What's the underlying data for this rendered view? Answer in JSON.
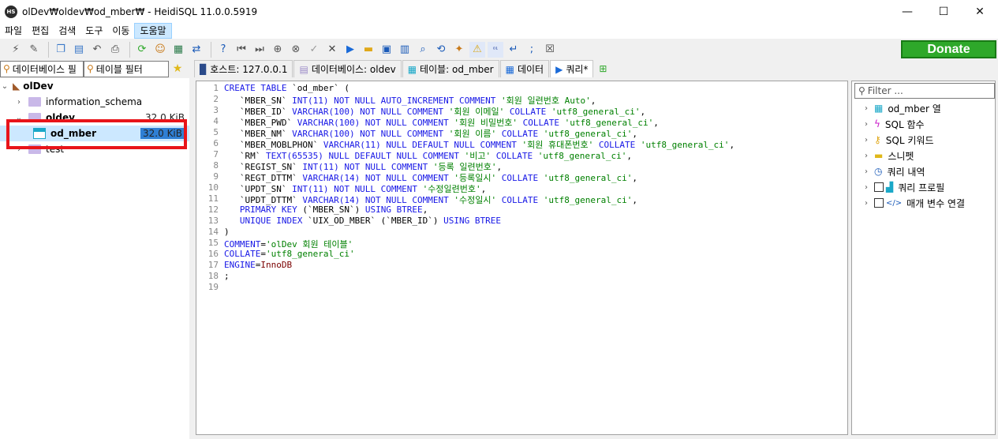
{
  "window": {
    "title": "olDev₩oldev₩od_mber₩ - HeidiSQL 11.0.0.5919",
    "app_icon_text": "HS",
    "minimize": "—",
    "maximize": "☐",
    "close": "✕"
  },
  "menu": [
    "파일",
    "편집",
    "검색",
    "도구",
    "이동",
    "도움말"
  ],
  "donate_label": "Donate",
  "left": {
    "db_filter": "데이터베이스 필",
    "table_filter": "테이블 필터",
    "tree": [
      {
        "label": "olDev",
        "size": ""
      },
      {
        "label": "information_schema",
        "size": ""
      },
      {
        "label": "oldev",
        "size": "32.0 KiB"
      },
      {
        "label": "od_mber",
        "size": "32.0 KiB"
      },
      {
        "label": "test",
        "size": ""
      }
    ]
  },
  "tabs": [
    "호스트: 127.0.0.1",
    "데이터베이스: oldev",
    "테이블: od_mber",
    "데이터",
    "쿼리*"
  ],
  "editor": {
    "line_numbers": [
      "1",
      "2",
      "3",
      "4",
      "5",
      "6",
      "7",
      "8",
      "9",
      "10",
      "11",
      "12",
      "13",
      "14",
      "15",
      "16",
      "17",
      "18",
      "19"
    ]
  },
  "helper": {
    "filter_placeholder": "Filter ...",
    "items": [
      "od_mber 열",
      "SQL 함수",
      "SQL 키워드",
      "스니펫",
      "쿼리 내역",
      "쿼리 프로필",
      "매개 변수 연결"
    ]
  },
  "colors": {
    "keyword": "#1717e6",
    "string": "#008000",
    "donate": "#2ea82a",
    "highlight": "#e8141a"
  }
}
